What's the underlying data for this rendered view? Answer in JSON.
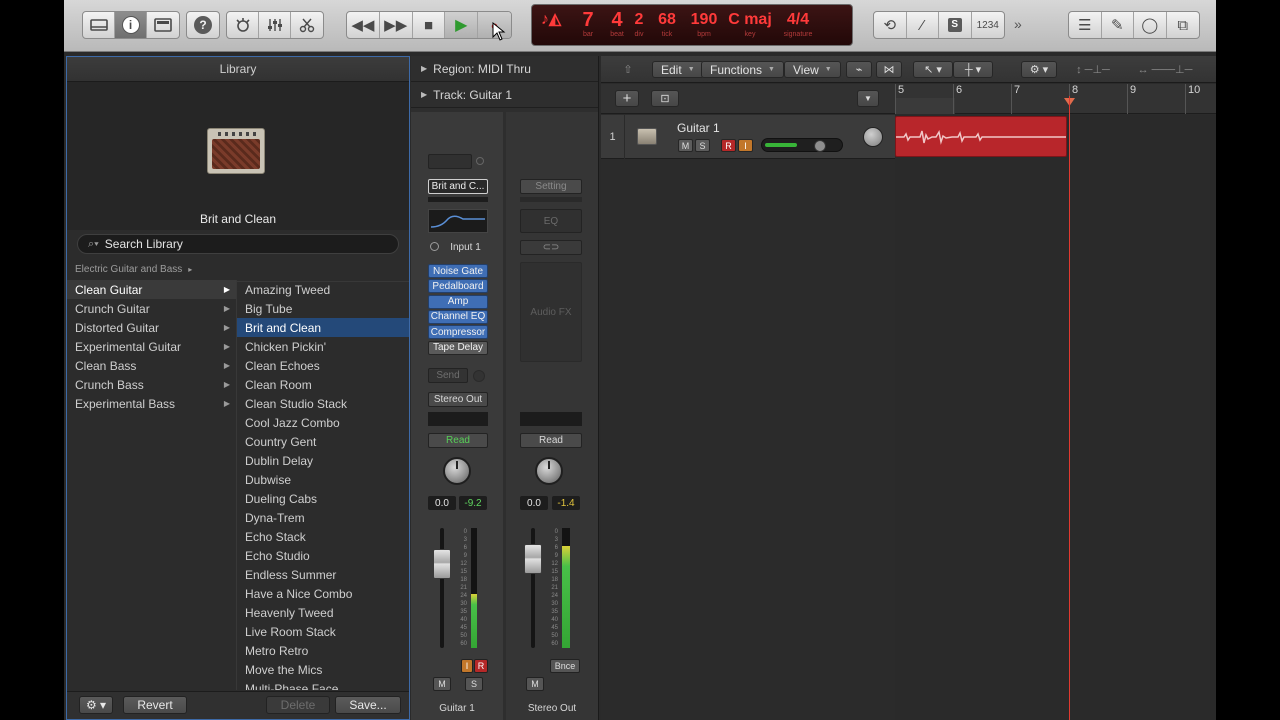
{
  "control_bar": {
    "lcd": {
      "bar": "7",
      "beat": "4",
      "div": "2",
      "tick": "68",
      "bpm": "190",
      "key": "C maj",
      "signature": "4/4",
      "labels": {
        "bar": "bar",
        "beat": "beat",
        "div": "div",
        "tick": "tick",
        "bpm": "bpm",
        "key": "key",
        "signature": "signature"
      }
    },
    "counter": "1234"
  },
  "library": {
    "header": "Library",
    "preview_title": "Brit and Clean",
    "search_placeholder": "Search Library",
    "breadcrumb": "Electric Guitar and Bass",
    "categories": [
      "Clean Guitar",
      "Crunch Guitar",
      "Distorted Guitar",
      "Experimental Guitar",
      "Clean Bass",
      "Crunch Bass",
      "Experimental Bass"
    ],
    "patches": [
      "Amazing Tweed",
      "Big Tube",
      "Brit and Clean",
      "Chicken Pickin'",
      "Clean Echoes",
      "Clean Room",
      "Clean Studio Stack",
      "Cool Jazz Combo",
      "Country Gent",
      "Dublin Delay",
      "Dubwise",
      "Dueling Cabs",
      "Dyna-Trem",
      "Echo Stack",
      "Echo Studio",
      "Endless Summer",
      "Have a Nice Combo",
      "Heavenly Tweed",
      "Live Room Stack",
      "Metro Retro",
      "Move the Mics",
      "Multi-Phase Face"
    ],
    "footer": {
      "revert": "Revert",
      "delete": "Delete",
      "save": "Save..."
    }
  },
  "inspector": {
    "region": "Region: MIDI Thru",
    "track": "Track:  Guitar 1",
    "left_strip": {
      "setting": "Brit and C...",
      "input": "Input 1",
      "plugins": [
        "Noise Gate",
        "Pedalboard",
        "Amp",
        "Channel EQ",
        "Compressor",
        "Tape Delay"
      ],
      "send": "Send",
      "output": "Stereo Out",
      "automation": "Read",
      "pan_value": "0.0",
      "peak_value": "-9.2",
      "input_btn": "I",
      "rec_btn": "R",
      "mute": "M",
      "solo": "S",
      "name": "Guitar 1",
      "meter_level": 0.45
    },
    "right_strip": {
      "setting": "Setting",
      "eq": "EQ",
      "audio_fx": "Audio FX",
      "automation": "Read",
      "pan_value": "0.0",
      "peak_value": "-1.4",
      "bounce": "Bnce",
      "mute": "M",
      "name": "Stereo Out",
      "meter_level": 0.85
    },
    "scale_labels": [
      "0",
      "3",
      "6",
      "9",
      "12",
      "15",
      "18",
      "21",
      "24",
      "30",
      "35",
      "40",
      "45",
      "50",
      "60"
    ]
  },
  "tracks": {
    "menus": {
      "edit": "Edit",
      "functions": "Functions",
      "view": "View"
    },
    "ruler_bars": [
      "5",
      "6",
      "7",
      "8",
      "9",
      "10"
    ],
    "track": {
      "number": "1",
      "name": "Guitar 1",
      "mute": "M",
      "solo": "S",
      "record": "R",
      "input": "I",
      "volume_level": 0.4
    }
  },
  "colors": {
    "region": "#b8262b",
    "plugin_blue": "#3f6eb5",
    "lcd_red": "#ff3a3a",
    "playhead": "#e0392f",
    "selection_blue": "#244979"
  }
}
